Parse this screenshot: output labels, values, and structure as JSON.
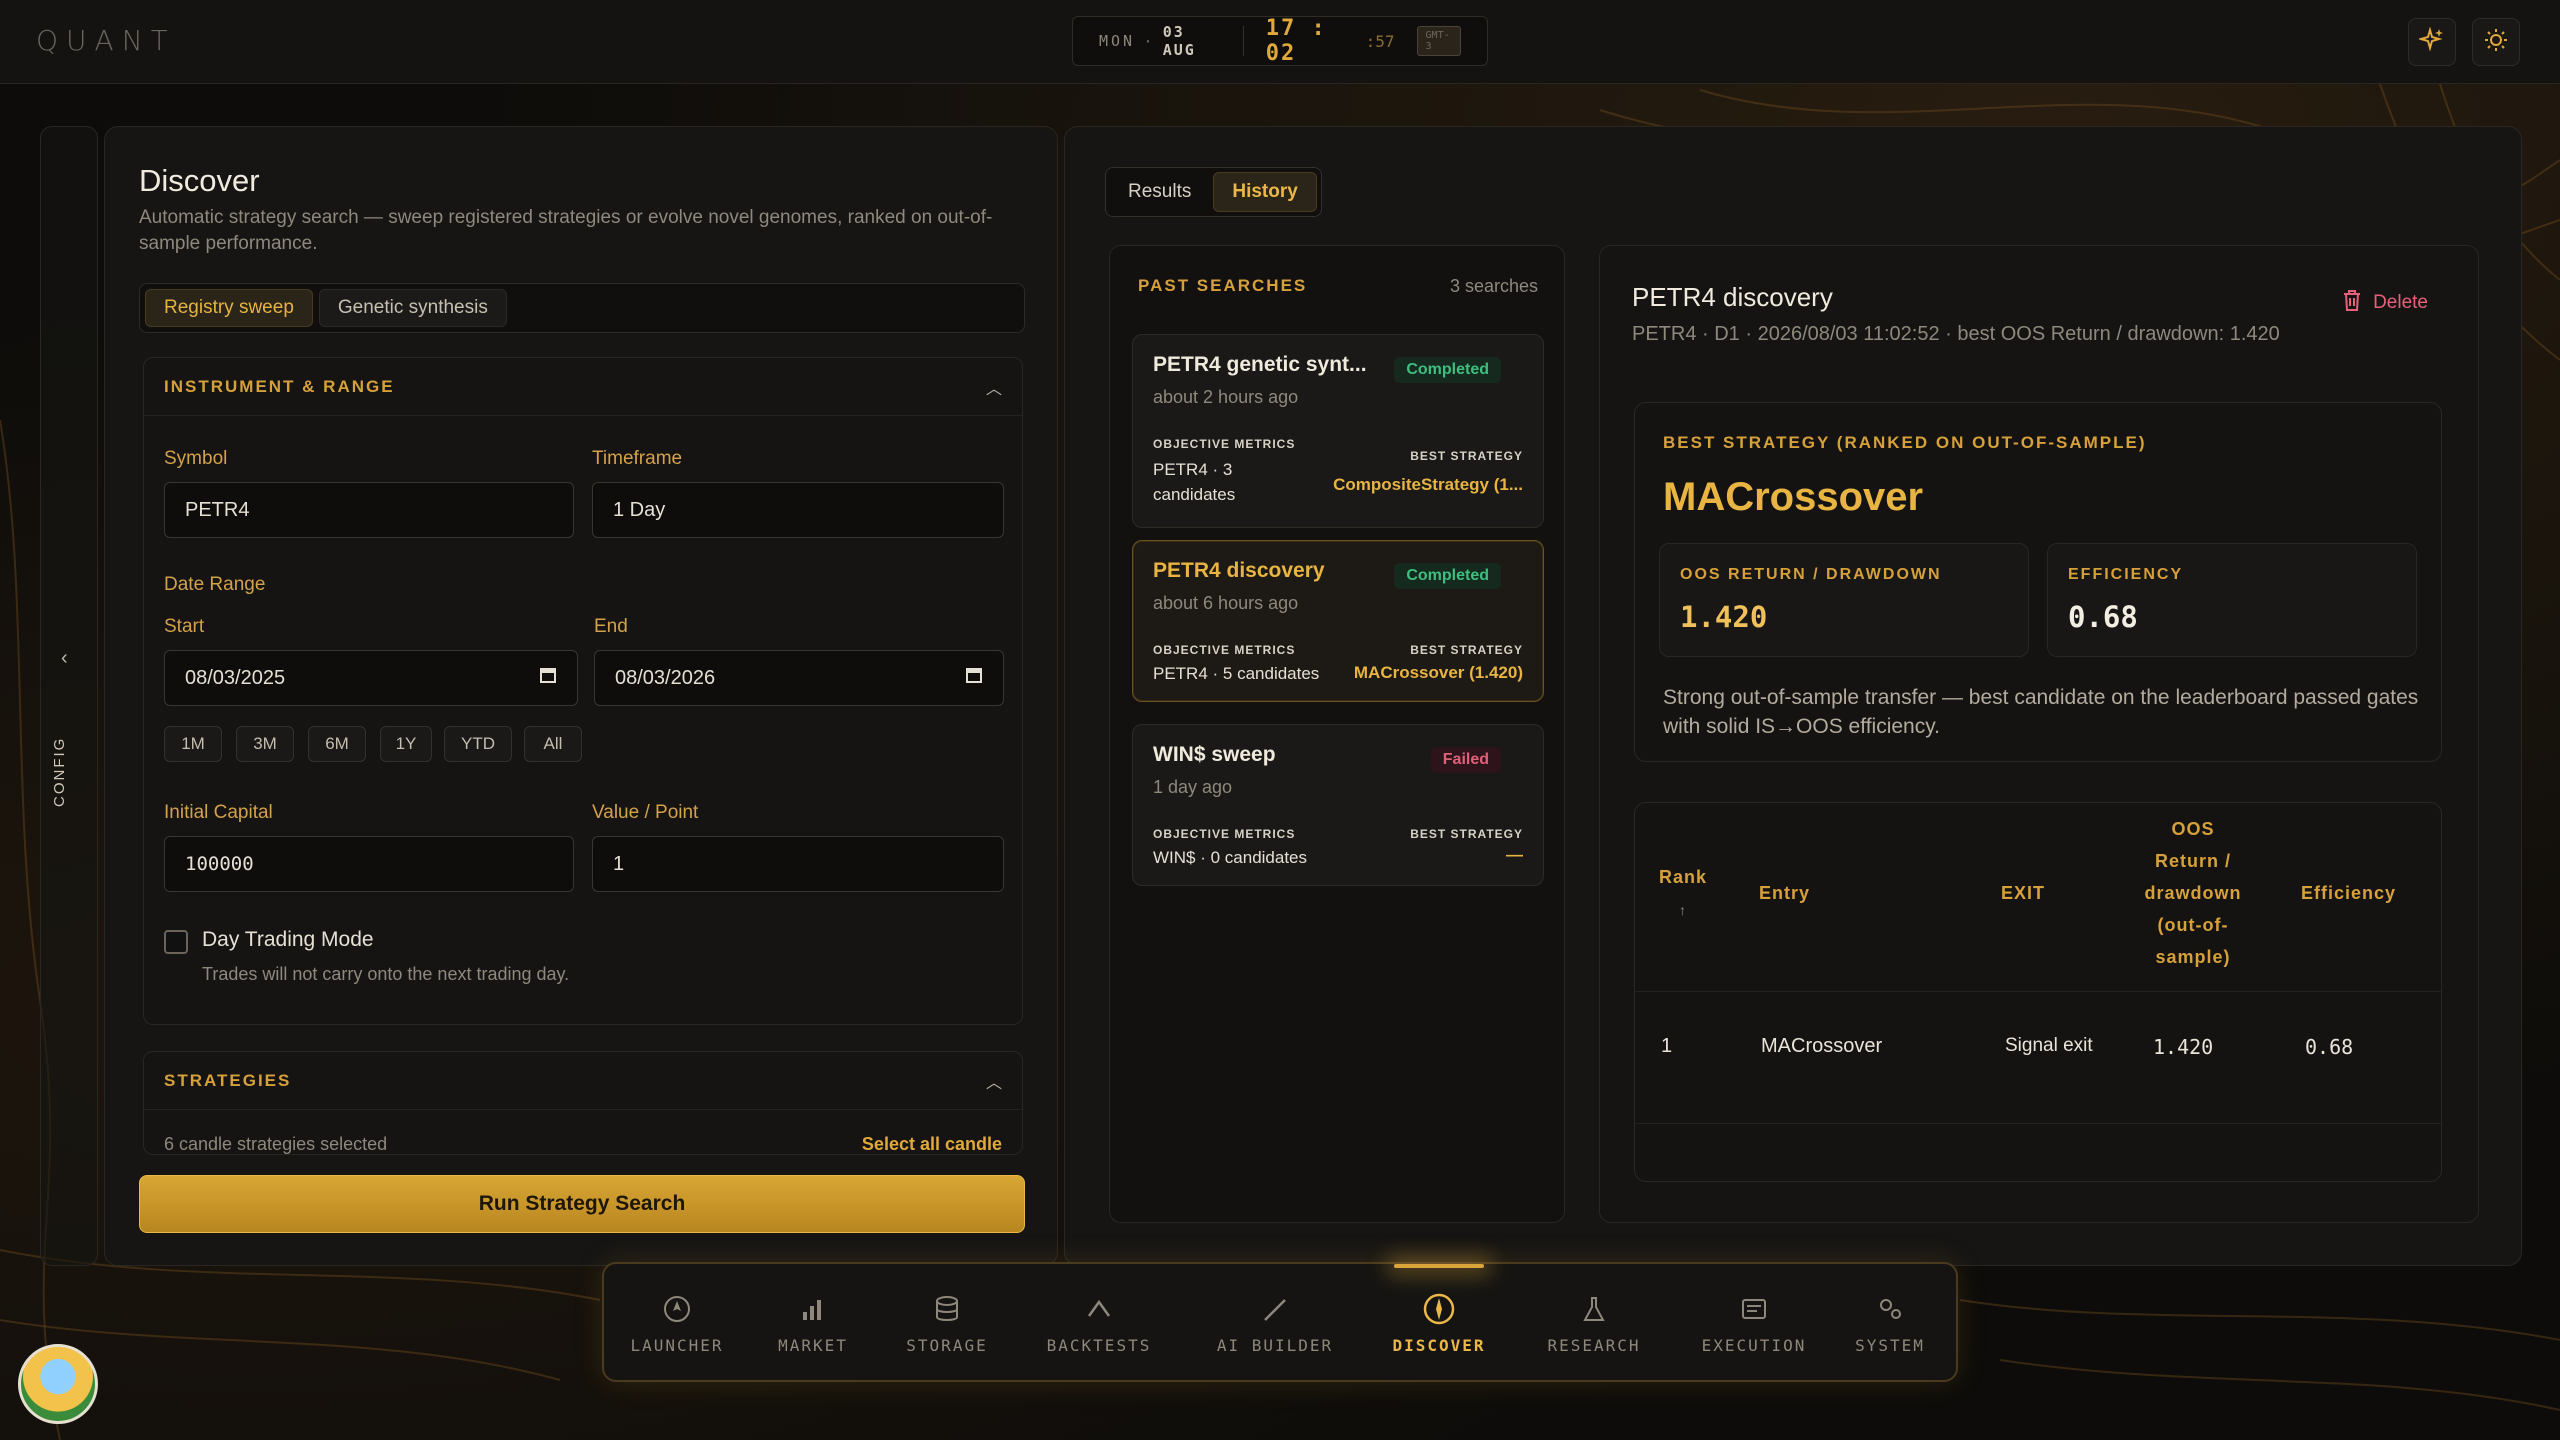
{
  "app": {
    "logo": "QUANT"
  },
  "clock": {
    "day": "MON",
    "date": "03 AUG",
    "hm": "17 : 02",
    "sec": ":57",
    "tz": "GMT-3"
  },
  "rail": {
    "label": "CONFIG"
  },
  "discover": {
    "title": "Discover",
    "description": "Automatic strategy search — sweep registered strategies or evolve novel genomes, ranked on out-of-sample performance.",
    "modes": [
      "Registry sweep",
      "Genetic synthesis"
    ],
    "instrument": {
      "title": "INSTRUMENT & RANGE",
      "symbol_label": "Symbol",
      "symbol": "PETR4",
      "timeframe_label": "Timeframe",
      "timeframe": "1 Day",
      "date_range_label": "Date Range",
      "start_label": "Start",
      "start": "08/03/2025",
      "end_label": "End",
      "end": "08/03/2026",
      "quick": [
        "1M",
        "3M",
        "6M",
        "1Y",
        "YTD",
        "All"
      ],
      "capital_label": "Initial Capital",
      "capital": "100000",
      "value_point_label": "Value / Point",
      "value_point": "1",
      "day_trading_label": "Day Trading Mode",
      "day_trading_hint": "Trades will not carry onto the next trading day."
    },
    "strategies": {
      "title": "STRATEGIES",
      "selected": "6 candle strategies selected",
      "select_all": "Select all candle"
    },
    "run_label": "Run Strategy Search"
  },
  "results": {
    "tabs": [
      "Results",
      "History"
    ],
    "past": {
      "title": "PAST SEARCHES",
      "count": "3 searches",
      "objective_label": "OBJECTIVE METRICS",
      "best_label": "BEST STRATEGY",
      "items": [
        {
          "name": "PETR4 genetic synt...",
          "when": "about 2 hours ago",
          "status": "Completed",
          "objective": "PETR4 · 3 candidates",
          "best": "CompositeStrategy (1..."
        },
        {
          "name": "PETR4 discovery",
          "when": "about 6 hours ago",
          "status": "Completed",
          "objective": "PETR4 · 5 candidates",
          "best": "MACrossover (1.420)"
        },
        {
          "name": "WIN$ sweep",
          "when": "1 day ago",
          "status": "Failed",
          "objective": "WIN$ · 0 candidates",
          "best": "—"
        }
      ]
    },
    "detail": {
      "title": "PETR4 discovery",
      "subtitle": "PETR4 · D1 · 2026/08/03 11:02:52 · best OOS Return / drawdown: 1.420",
      "delete_label": "Delete",
      "best_title": "BEST STRATEGY (RANKED ON OUT-OF-SAMPLE)",
      "best_name": "MACrossover",
      "oos_label": "OOS RETURN / DRAWDOWN",
      "oos_value": "1.420",
      "eff_label": "EFFICIENCY",
      "eff_value": "0.68",
      "note": "Strong out-of-sample transfer — best candidate on the leaderboard passed gates with solid IS→OOS efficiency.",
      "table": {
        "headers": {
          "rank": "Rank",
          "rank_sort": "↑",
          "entry": "Entry",
          "exit": "EXIT",
          "oos": "OOS Return / drawdown (out-of-sample)",
          "eff": "Efficiency"
        },
        "rows": [
          {
            "rank": "1",
            "entry": "MACrossover",
            "exit": "Signal exit",
            "oos": "1.420",
            "eff": "0.68"
          }
        ]
      }
    }
  },
  "dock": [
    "LAUNCHER",
    "MARKET",
    "STORAGE",
    "BACKTESTS",
    "AI BUILDER",
    "DISCOVER",
    "RESEARCH",
    "EXECUTION",
    "SYSTEM"
  ],
  "colors": {
    "accent": "#e0a93a",
    "success": "#3fbf7f",
    "danger": "#e0607a"
  }
}
